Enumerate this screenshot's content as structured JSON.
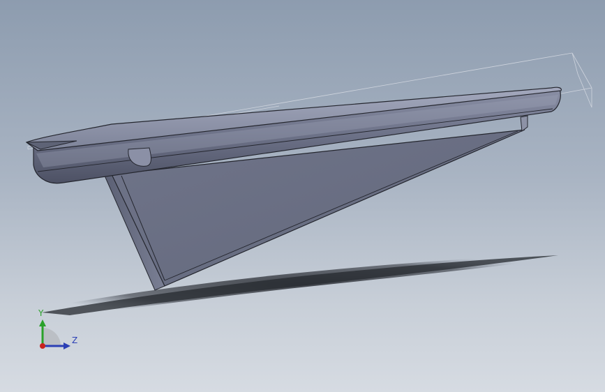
{
  "triad": {
    "y_label": "Y",
    "z_label": "Z",
    "y_color": "#2aa12a",
    "z_color": "#2b3fb5",
    "origin_color": "#c8231e"
  },
  "colors": {
    "background_top": "#8d9caf",
    "background_bottom": "#d6dbe2",
    "part_top": "#8f95ab",
    "part_face": "#6e7388",
    "part_edge": "#24262e",
    "shadow": "#2a2d33"
  }
}
